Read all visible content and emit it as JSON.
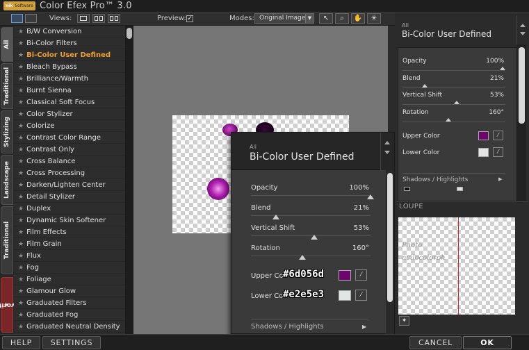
{
  "app": {
    "title": "Color Efex Pro™ 3.0",
    "logo_text": "nik",
    "logo_subtext": "Software"
  },
  "toolbar": {
    "views_label": "Views:",
    "preview_label": "Preview:",
    "preview_checked": true,
    "modes_label": "Modes:",
    "modes_value": "Original Image",
    "tools": [
      "pointer-icon",
      "zoom-icon",
      "hand-icon",
      "loupe-toggle-icon"
    ]
  },
  "tabs": [
    "All",
    "Traditional",
    "Stylizing",
    "Landscape",
    "Traditional",
    "Favorites"
  ],
  "filters": [
    "B/W Conversion",
    "Bi-Color Filters",
    "Bi-Color User Defined",
    "Bleach Bypass",
    "Brilliance/Warmth",
    "Burnt Sienna",
    "Classical Soft Focus",
    "Color Stylizer",
    "Colorize",
    "Contrast Color Range",
    "Contrast Only",
    "Cross Balance",
    "Cross Processing",
    "Darken/Lighten Center",
    "Detail Stylizer",
    "Duplex",
    "Dynamic Skin Softener",
    "Film Effects",
    "Film Grain",
    "Flux",
    "Fog",
    "Foliage",
    "Glamour Glow",
    "Graduated Filters",
    "Graduated Fog",
    "Graduated Neutral Density"
  ],
  "active_filter": "Bi-Color User Defined",
  "overlay": {
    "category": "All",
    "title": "Bi-Color User Defined",
    "opacity_label": "Opacity",
    "opacity_value": "100%",
    "opacity_level": 1.0,
    "blend_label": "Blend",
    "blend_value": "21%",
    "blend_level": 0.21,
    "vshift_label": "Vertical Shift",
    "vshift_value": "53%",
    "vshift_level": 0.53,
    "rotation_label": "Rotation",
    "rotation_value": "160°",
    "upper_color_label": "Upper Co",
    "upper_color_hex": "#6d056d",
    "lower_color_label": "Lower Co",
    "lower_color_hex": "#e2e5e3",
    "shadows_label": "Shadows / Highlights"
  },
  "right_panel": {
    "category": "All",
    "title": "Bi-Color User Defined",
    "opacity_label": "Opacity",
    "opacity_value": "100%",
    "blend_label": "Blend",
    "blend_value": "21%",
    "vshift_label": "Vertical Shift",
    "vshift_value": "53%",
    "rotation_label": "Rotation",
    "rotation_value": "160°",
    "upper_color_label": "Upper Color",
    "upper_color_hex": "#6d056d",
    "lower_color_label": "Lower Color",
    "lower_color_hex": "#e2e5e3",
    "shadows_label": "Shadows / Highlights"
  },
  "loupe": {
    "label": "LOUPE",
    "watermark_line1": "Photo",
    "watermark_line2": "ncilocoloroh"
  },
  "buttons": {
    "help": "HELP",
    "settings": "SETTINGS",
    "cancel": "CANCEL",
    "ok": "OK"
  }
}
